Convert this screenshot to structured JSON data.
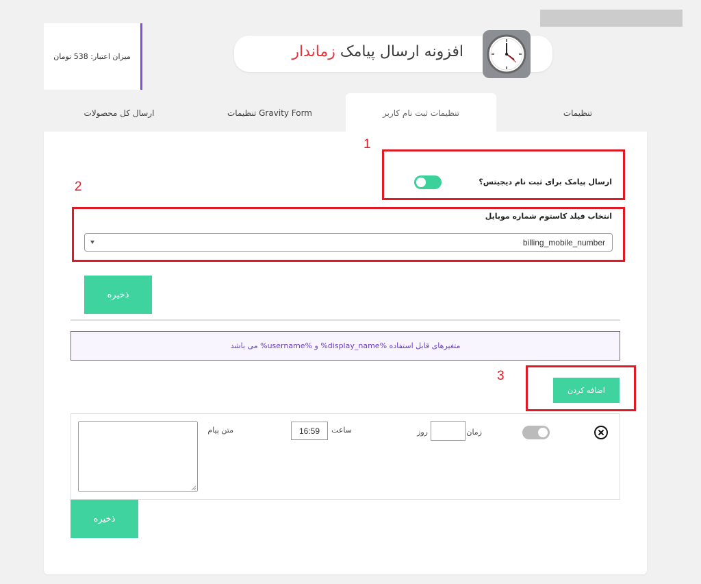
{
  "header": {
    "credit_text": "میزان اعتبار: 538 تومان",
    "title_main": "افزونه ارسال پیامک ",
    "title_accent": "زماندار",
    "clock_icon": "clock-icon"
  },
  "tabs": [
    {
      "label": "تنظیمات"
    },
    {
      "label": "تنظیمات ثبت نام کاربر",
      "active": true
    },
    {
      "label": "تنظیمات Gravity Form"
    },
    {
      "label": "ارسال کل محصولات"
    }
  ],
  "annotations": {
    "one": "1",
    "two": "2",
    "three": "3"
  },
  "digits": {
    "toggle_label": "ارسال پیامک برای ثبت نام دیجیتس؟",
    "toggle_on": true
  },
  "mobile_field": {
    "label": "انتخاب فیلد کاستوم شماره موبایل",
    "selected": "billing_mobile_number"
  },
  "buttons": {
    "save_top": "ذخیره",
    "add": "اضافه کردن",
    "save_bottom": "ذخیره"
  },
  "info": {
    "text": "متغیرهای قابل استفاده %display_name% و %username% می باشد"
  },
  "message_row": {
    "time_label": "زمان",
    "day_label": "روز",
    "day_value": "",
    "hour_label": "ساعت",
    "hour_value": "16:59",
    "message_label": "متن پیام",
    "message_value": "",
    "toggle_on": false
  },
  "colors": {
    "accent": "#3fd3a0",
    "purple": "#7b4fd9",
    "red": "#e01a24"
  }
}
